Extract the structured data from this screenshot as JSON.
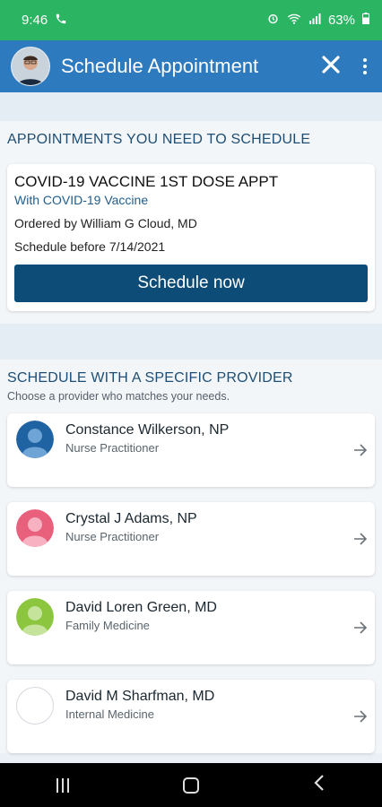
{
  "status": {
    "time": "9:46",
    "battery": "63%"
  },
  "header": {
    "title": "Schedule Appointment"
  },
  "appointments_section": {
    "title": "APPOINTMENTS YOU NEED TO SCHEDULE",
    "card": {
      "name": "COVID-19 VACCINE 1ST DOSE APPT",
      "with": "With COVID-19 Vaccine",
      "ordered_by": "Ordered by William G Cloud, MD",
      "schedule_before": "Schedule before 7/14/2021",
      "button_label": "Schedule now"
    }
  },
  "provider_section": {
    "title": "SCHEDULE WITH A SPECIFIC PROVIDER",
    "subtitle": "Choose a provider who matches your needs.",
    "providers": [
      {
        "name": "Constance Wilkerson, NP",
        "specialty": "Nurse Practitioner",
        "avatar_color": "#1f63a3"
      },
      {
        "name": "Crystal J Adams, NP",
        "specialty": "Nurse Practitioner",
        "avatar_color": "#e8607c"
      },
      {
        "name": "David Loren Green, MD",
        "specialty": "Family Medicine",
        "avatar_color": "#8cc63f"
      },
      {
        "name": "David M Sharfman, MD",
        "specialty": "Internal Medicine",
        "avatar_color": "#ffffff"
      }
    ]
  },
  "icons": {
    "close": "close-icon",
    "menu": "more-vert-icon",
    "arrow": "arrow-right-icon"
  }
}
